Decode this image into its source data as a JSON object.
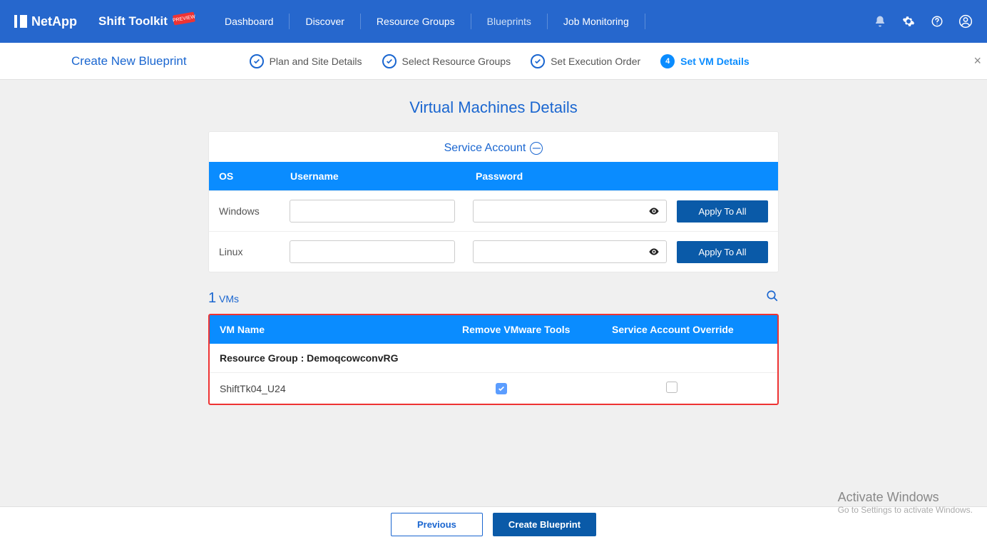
{
  "brand": {
    "company": "NetApp",
    "product": "Shift Toolkit",
    "badge": "PREVIEW"
  },
  "nav": {
    "items": [
      {
        "label": "Dashboard"
      },
      {
        "label": "Discover"
      },
      {
        "label": "Resource Groups"
      },
      {
        "label": "Blueprints",
        "active": true
      },
      {
        "label": "Job Monitoring"
      }
    ]
  },
  "wizard": {
    "title": "Create New Blueprint",
    "steps": [
      {
        "label": "Plan and Site Details",
        "state": "done"
      },
      {
        "label": "Select Resource Groups",
        "state": "done"
      },
      {
        "label": "Set Execution Order",
        "state": "done"
      },
      {
        "num": "4",
        "label": "Set VM Details",
        "state": "active"
      }
    ]
  },
  "page": {
    "heading": "Virtual Machines Details",
    "service_account": {
      "title": "Service Account",
      "headers": {
        "os": "OS",
        "user": "Username",
        "pass": "Password"
      },
      "rows": [
        {
          "os": "Windows",
          "apply": "Apply To All"
        },
        {
          "os": "Linux",
          "apply": "Apply To All"
        }
      ]
    },
    "vms": {
      "count": "1",
      "count_label": "VMs",
      "headers": {
        "name": "VM Name",
        "remove": "Remove VMware Tools",
        "override": "Service Account Override"
      },
      "group_prefix": "Resource Group : ",
      "group_name": "DemoqcowconvRG",
      "items": [
        {
          "name": "ShiftTk04_U24",
          "remove_checked": true,
          "override_checked": false
        }
      ]
    }
  },
  "footer": {
    "prev": "Previous",
    "create": "Create Blueprint"
  },
  "watermark": {
    "line1": "Activate Windows",
    "line2": "Go to Settings to activate Windows."
  }
}
